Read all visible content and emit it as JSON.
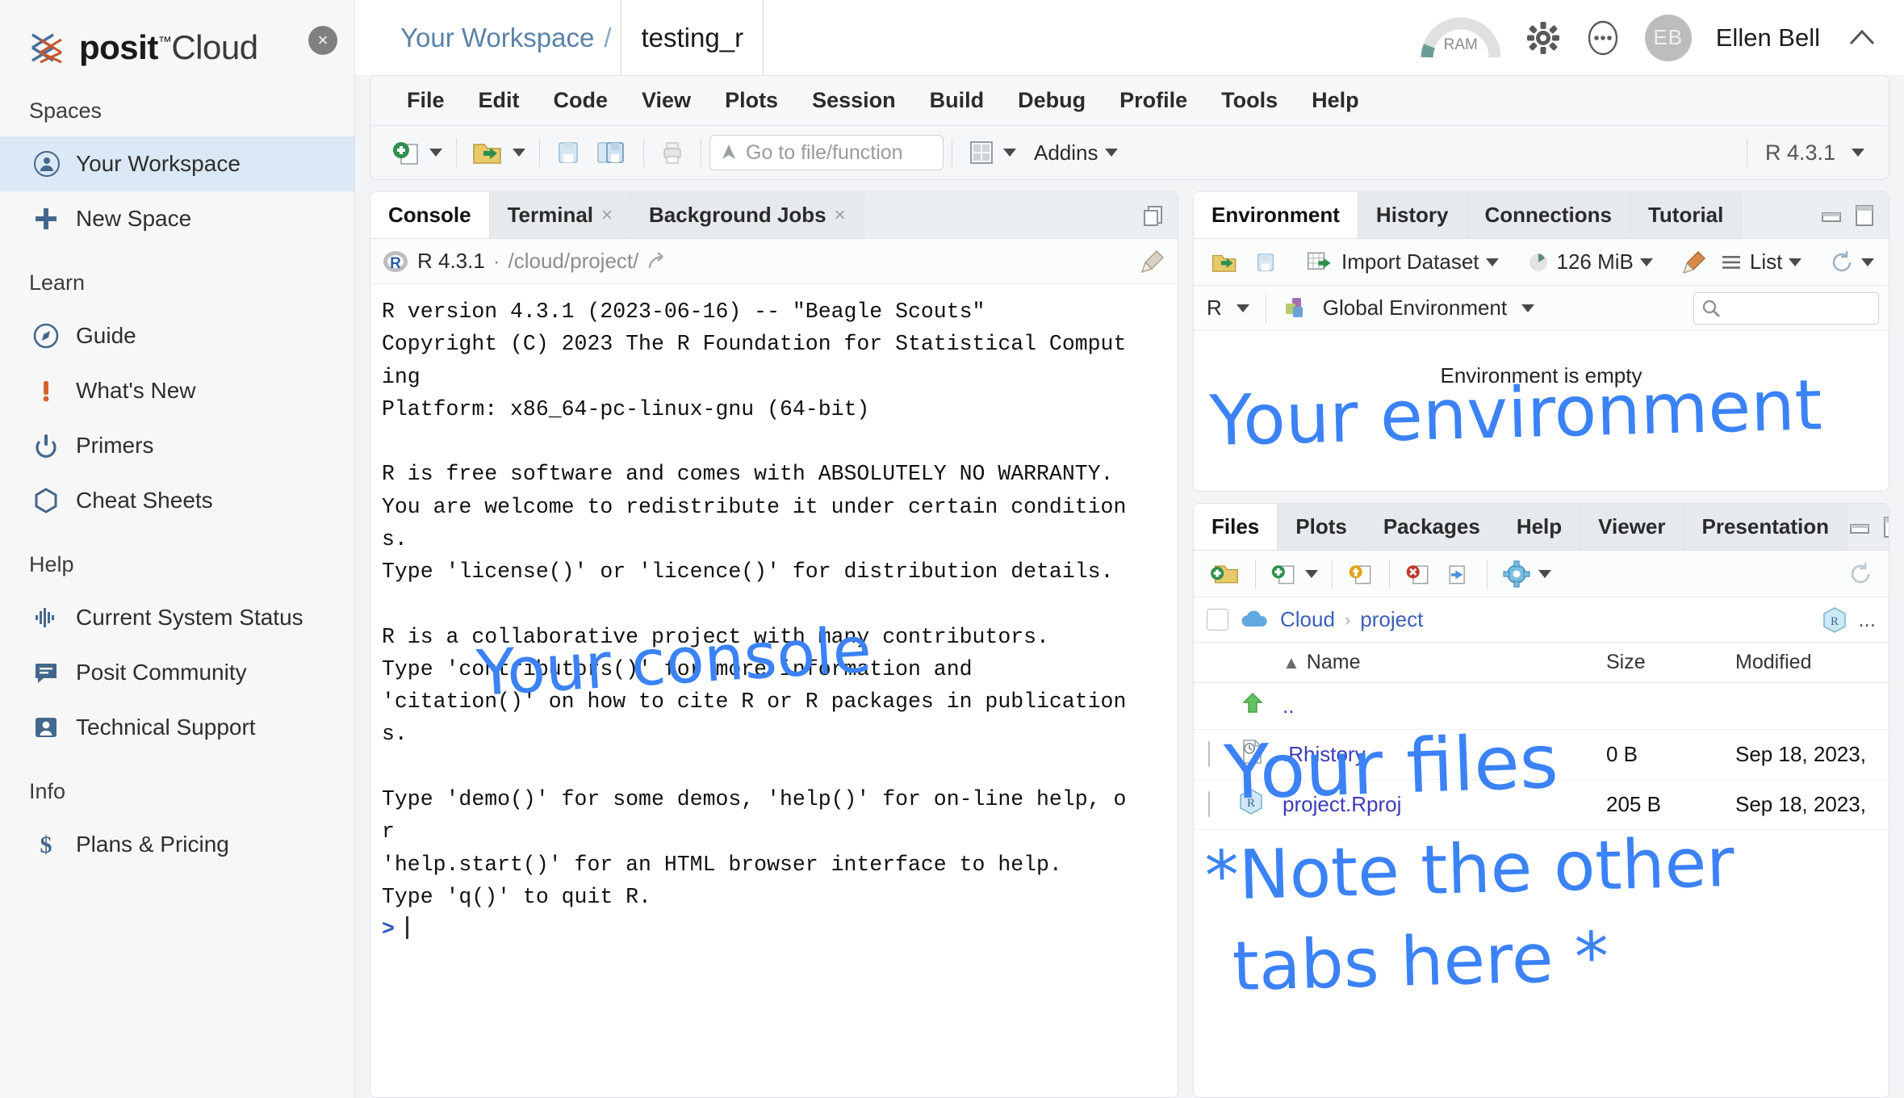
{
  "brand": {
    "name_bold": "posit",
    "tm": "™",
    "name_light": "Cloud",
    "close_label": "×"
  },
  "sidebar": {
    "sections": [
      {
        "label": "Spaces",
        "items": [
          {
            "label": "Your Workspace",
            "icon": "user-circle-icon",
            "active": true
          },
          {
            "label": "New Space",
            "icon": "plus-icon",
            "active": false
          }
        ]
      },
      {
        "label": "Learn",
        "items": [
          {
            "label": "Guide",
            "icon": "compass-icon",
            "active": false
          },
          {
            "label": "What's New",
            "icon": "exclamation-icon",
            "active": false
          },
          {
            "label": "Primers",
            "icon": "power-icon",
            "active": false
          },
          {
            "label": "Cheat Sheets",
            "icon": "hexagon-icon",
            "active": false
          }
        ]
      },
      {
        "label": "Help",
        "items": [
          {
            "label": "Current System Status",
            "icon": "pulse-icon",
            "active": false
          },
          {
            "label": "Posit Community",
            "icon": "chat-icon",
            "active": false
          },
          {
            "label": "Technical Support",
            "icon": "person-card-icon",
            "active": false
          }
        ]
      },
      {
        "label": "Info",
        "items": [
          {
            "label": "Plans & Pricing",
            "icon": "dollar-icon",
            "active": false
          }
        ]
      }
    ]
  },
  "topbar": {
    "workspace": "Your Workspace",
    "separator": "/",
    "project_name": "testing_r",
    "ram_label": "RAM",
    "user_initials": "EB",
    "user_name": "Ellen Bell"
  },
  "menubar": {
    "items": [
      "File",
      "Edit",
      "Code",
      "View",
      "Plots",
      "Session",
      "Build",
      "Debug",
      "Profile",
      "Tools",
      "Help"
    ]
  },
  "toolbar": {
    "goto_placeholder": "Go to file/function",
    "addins_label": "Addins",
    "r_version": "R 4.3.1"
  },
  "console": {
    "tabs": [
      {
        "label": "Console",
        "closable": false,
        "active": true
      },
      {
        "label": "Terminal",
        "closable": true,
        "active": false
      },
      {
        "label": "Background Jobs",
        "closable": true,
        "active": false
      }
    ],
    "close_glyph": "×",
    "r_version": "R 4.3.1",
    "separator": "·",
    "path": "/cloud/project/",
    "output": "R version 4.3.1 (2023-06-16) -- \"Beagle Scouts\"\nCopyright (C) 2023 The R Foundation for Statistical Comput\ning\nPlatform: x86_64-pc-linux-gnu (64-bit)\n\nR is free software and comes with ABSOLUTELY NO WARRANTY.\nYou are welcome to redistribute it under certain condition\ns.\nType 'license()' or 'licence()' for distribution details.\n\nR is a collaborative project with many contributors.\nType 'contributors()' for more information and\n'citation()' on how to cite R or R packages in publication\ns.\n\nType 'demo()' for some demos, 'help()' for on-line help, o\nr\n'help.start()' for an HTML browser interface to help.\nType 'q()' to quit R.\n",
    "prompt": ">"
  },
  "environment": {
    "tabs": [
      {
        "label": "Environment",
        "active": true
      },
      {
        "label": "History",
        "active": false
      },
      {
        "label": "Connections",
        "active": false
      },
      {
        "label": "Tutorial",
        "active": false
      }
    ],
    "import_label": "Import Dataset",
    "memory_label": "126 MiB",
    "view_mode": "List",
    "scope_r": "R",
    "scope_env": "Global Environment",
    "empty_message": "Environment is empty"
  },
  "files": {
    "tabs": [
      {
        "label": "Files",
        "active": true
      },
      {
        "label": "Plots",
        "active": false
      },
      {
        "label": "Packages",
        "active": false
      },
      {
        "label": "Help",
        "active": false
      },
      {
        "label": "Viewer",
        "active": false
      },
      {
        "label": "Presentation",
        "active": false
      }
    ],
    "breadcrumb": [
      "Cloud",
      "project"
    ],
    "breadcrumb_sep": "›",
    "more_label": "...",
    "columns": [
      "Name",
      "Size",
      "Modified"
    ],
    "sort_arrow": "▲",
    "rows": [
      {
        "name": "..",
        "size": "",
        "modified": "",
        "icon": "up-arrow-icon",
        "has_checkbox": false
      },
      {
        "name": ".Rhistory",
        "size": "0 B",
        "modified": "Sep 18, 2023,",
        "icon": "history-file-icon",
        "has_checkbox": true
      },
      {
        "name": "project.Rproj",
        "size": "205 B",
        "modified": "Sep 18, 2023,",
        "icon": "rproj-icon",
        "has_checkbox": true
      }
    ]
  },
  "annotations": [
    {
      "text": "Your environment",
      "name": "annotation-your-environment"
    },
    {
      "text": "Your console",
      "name": "annotation-your-console"
    },
    {
      "text": "Your files",
      "name": "annotation-your-files"
    },
    {
      "text": "*Note the other",
      "name": "annotation-note-other-1"
    },
    {
      "text": "tabs here *",
      "name": "annotation-note-other-2"
    }
  ],
  "colors": {
    "accent_blue": "#3b82f6",
    "sidebar_active": "#dbe8f5",
    "link_blue": "#5b82a8",
    "icon_blue": "#44688c"
  }
}
